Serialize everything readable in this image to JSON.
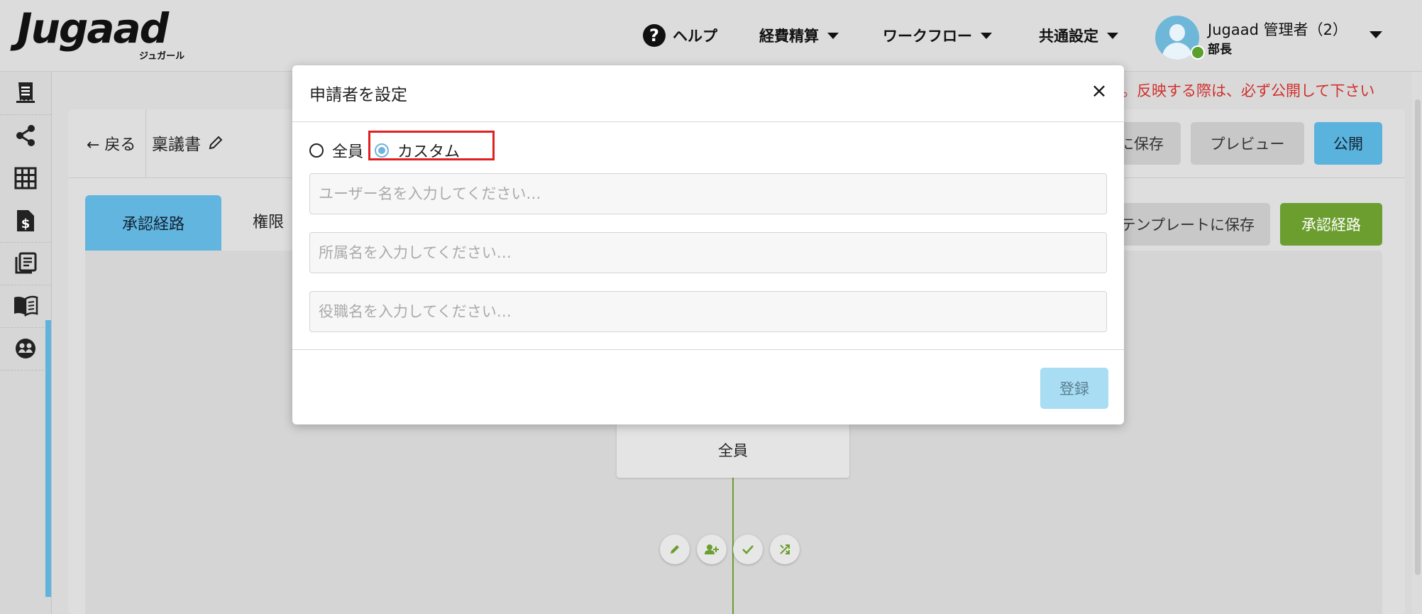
{
  "header": {
    "logo_text": "Jugaad",
    "logo_sub": "ジュガール",
    "help_label": "ヘルプ",
    "nav": [
      "経費精算",
      "ワークフロー",
      "共通設定"
    ],
    "user_name": "Jugaad 管理者（2）",
    "user_role": "部長"
  },
  "sidebar": {
    "icons": [
      "receipt-icon",
      "share-icon",
      "grid-icon",
      "invoice-icon",
      "document-list-icon",
      "book-icon",
      "group-icon"
    ]
  },
  "notice": {
    "warning": "ん。反映する際は、必ず公開して下さい"
  },
  "toolbar": {
    "back_label": "← 戻る",
    "doc_title": "稟議書",
    "save_label": "に保存",
    "preview_label": "プレビュー",
    "publish_label": "公開",
    "template_save_label": "テンプレートに保存",
    "route_label": "承認経路"
  },
  "tabs": {
    "active": "承認経路",
    "other": "権限"
  },
  "flow": {
    "node_label": "全員",
    "actions": [
      "edit-icon",
      "add-user-icon",
      "check-icon",
      "shuffle-icon"
    ]
  },
  "modal": {
    "title": "申請者を設定",
    "close": "×",
    "radio_all": "全員",
    "radio_custom": "カスタム",
    "selected": "custom",
    "user_placeholder": "ユーザー名を入力してください…",
    "dept_placeholder": "所属名を入力してください…",
    "position_placeholder": "役職名を入力してください…",
    "submit_label": "登録"
  },
  "colors": {
    "accent_blue": "#5ab3dd",
    "accent_green": "#6b9e2e",
    "warning_red": "#d0312d",
    "highlight_red": "#e02020"
  }
}
